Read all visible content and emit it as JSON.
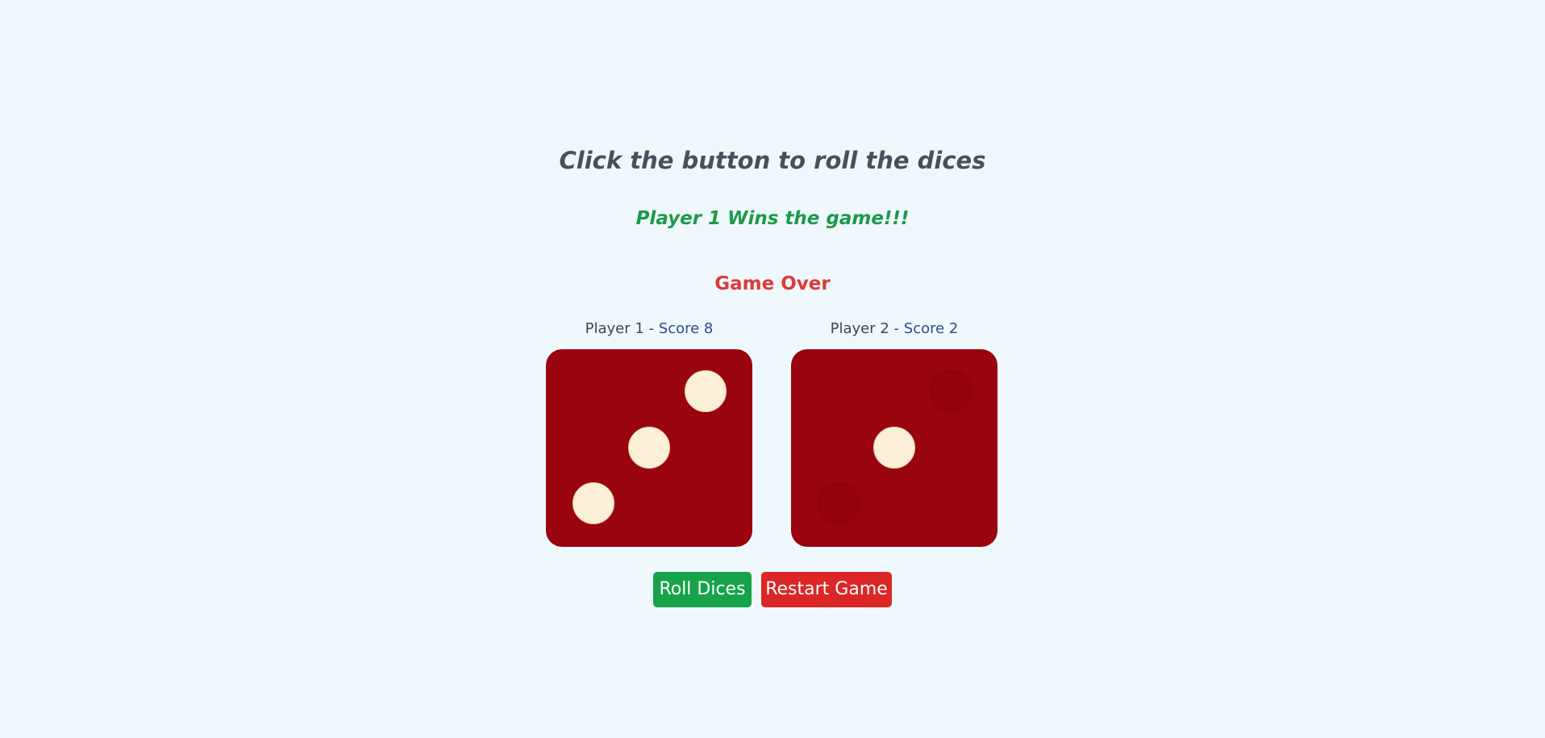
{
  "header": {
    "instruction": "Click the button to roll the dices",
    "winner_message": "Player 1 Wins the game!!!",
    "status": "Game Over"
  },
  "players": [
    {
      "name": "Player 1",
      "separator": " - ",
      "score_text": "Score 8",
      "die_value": 3
    },
    {
      "name": "Player 2",
      "separator": " - ",
      "score_text": "Score 2",
      "die_value": 1
    }
  ],
  "buttons": {
    "roll_label": "Roll Dices",
    "restart_label": "Restart Game"
  },
  "colors": {
    "background": "#eff8fd",
    "die": "#99040e",
    "pip": "#fcefd7",
    "winner": "#1c9a4a",
    "game_over": "#dc3a3a",
    "roll_button": "#16a34a",
    "restart_button": "#dc2626"
  }
}
